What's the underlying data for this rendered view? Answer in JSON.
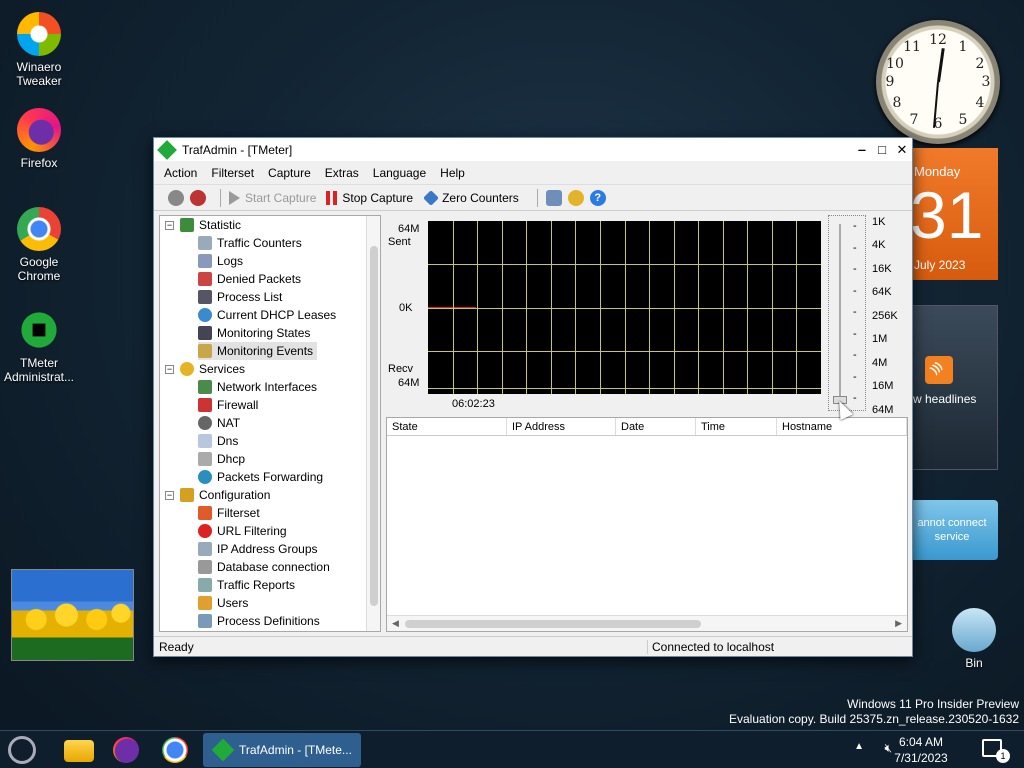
{
  "desktop": {
    "icons": [
      {
        "label": "Winaero Tweaker",
        "icon": "winaero-tweaker-icon"
      },
      {
        "label": "Firefox",
        "icon": "firefox-icon"
      },
      {
        "label": "Google Chrome",
        "icon": "chrome-icon"
      },
      {
        "label": "TMeter Administrat...",
        "icon": "tmeter-icon"
      },
      {
        "label": "Bin",
        "icon": "recycle-bin-icon"
      }
    ],
    "calendar": {
      "day": "Monday",
      "date": "31",
      "month": "July 2023"
    },
    "news": {
      "text": "w headlines"
    },
    "weather": {
      "text": "annot connect service"
    },
    "watermark": {
      "line1": "Windows 11 Pro Insider Preview",
      "line2": "Evaluation copy. Build 25375.zn_release.230520-1632"
    },
    "clock": {
      "numbers": [
        "12",
        "1",
        "2",
        "3",
        "4",
        "5",
        "6",
        "7",
        "8",
        "9",
        "10",
        "11"
      ]
    }
  },
  "window": {
    "title": "TrafAdmin - [TMeter]",
    "menu": [
      "Action",
      "Filterset",
      "Capture",
      "Extras",
      "Language",
      "Help"
    ],
    "toolbar": {
      "start_capture": "Start Capture",
      "stop_capture": "Stop Capture",
      "zero_counters": "Zero Counters"
    },
    "tree": {
      "statistic": "Statistic",
      "statistic_items": [
        "Traffic Counters",
        "Logs",
        "Denied Packets",
        "Process List",
        "Current DHCP Leases",
        "Monitoring States",
        "Monitoring Events"
      ],
      "services": "Services",
      "services_items": [
        "Network Interfaces",
        "Firewall",
        "NAT",
        "Dns",
        "Dhcp",
        "Packets Forwarding"
      ],
      "configuration": "Configuration",
      "configuration_items": [
        "Filterset",
        "URL Filtering",
        "IP Address Groups",
        "Database connection",
        "Traffic Reports",
        "Users",
        "Process Definitions"
      ]
    },
    "graph": {
      "sent_value": "64M",
      "sent_label": "Sent",
      "zero_label": "0K",
      "recv_label": "Recv",
      "recv_value": "64M",
      "time_label": "06:02:23",
      "scale": [
        "1K",
        "4K",
        "16K",
        "64K",
        "256K",
        "1M",
        "4M",
        "16M",
        "64M"
      ]
    },
    "table": {
      "columns": [
        "State",
        "IP Address",
        "Date",
        "Time",
        "Hostname"
      ]
    },
    "status": {
      "left": "Ready",
      "right": "Connected to localhost"
    }
  },
  "taskbar": {
    "active_task": "TrafAdmin - [TMete...",
    "time": "6:04 AM",
    "date": "7/31/2023",
    "notification_count": "1"
  }
}
